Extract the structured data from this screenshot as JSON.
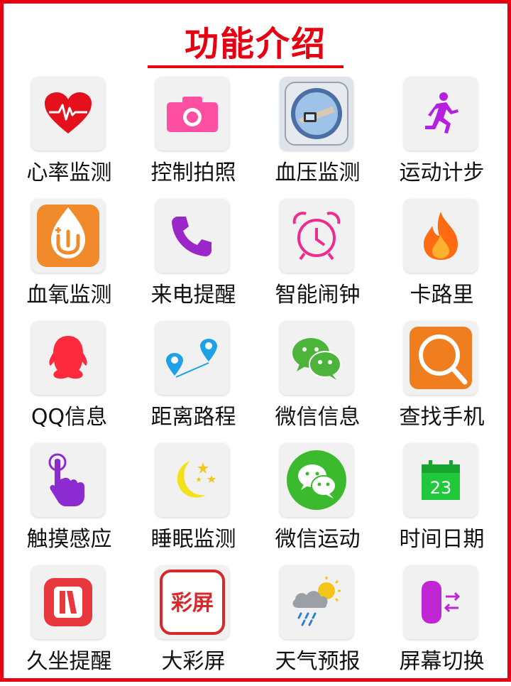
{
  "title": "功能介绍",
  "colors": {
    "accent": "#e60012",
    "tile_bg": "#f1f1f1"
  },
  "features": [
    {
      "label": "心率监测",
      "icon": "heart-rate-icon"
    },
    {
      "label": "控制拍照",
      "icon": "camera-icon"
    },
    {
      "label": "血压监测",
      "icon": "blood-pressure-icon"
    },
    {
      "label": "运动计步",
      "icon": "running-icon"
    },
    {
      "label": "血氧监测",
      "icon": "blood-oxygen-icon"
    },
    {
      "label": "来电提醒",
      "icon": "phone-icon"
    },
    {
      "label": "智能闹钟",
      "icon": "alarm-clock-icon"
    },
    {
      "label": "卡路里",
      "icon": "flame-icon"
    },
    {
      "label": "QQ信息",
      "icon": "qq-penguin-icon"
    },
    {
      "label": "距离路程",
      "icon": "route-pins-icon"
    },
    {
      "label": "微信信息",
      "icon": "wechat-icon"
    },
    {
      "label": "查找手机",
      "icon": "magnifier-icon"
    },
    {
      "label": "触摸感应",
      "icon": "touch-hand-icon"
    },
    {
      "label": "睡眠监测",
      "icon": "moon-stars-icon"
    },
    {
      "label": "微信运动",
      "icon": "wechat-sport-icon"
    },
    {
      "label": "时间日期",
      "icon": "calendar-icon"
    },
    {
      "label": "久坐提醒",
      "icon": "sedentary-icon"
    },
    {
      "label": "大彩屏",
      "icon": "color-screen-icon",
      "icon_text": "彩屏"
    },
    {
      "label": "天气预报",
      "icon": "weather-icon"
    },
    {
      "label": "屏幕切换",
      "icon": "screen-switch-icon"
    }
  ],
  "calendar_day": "23"
}
